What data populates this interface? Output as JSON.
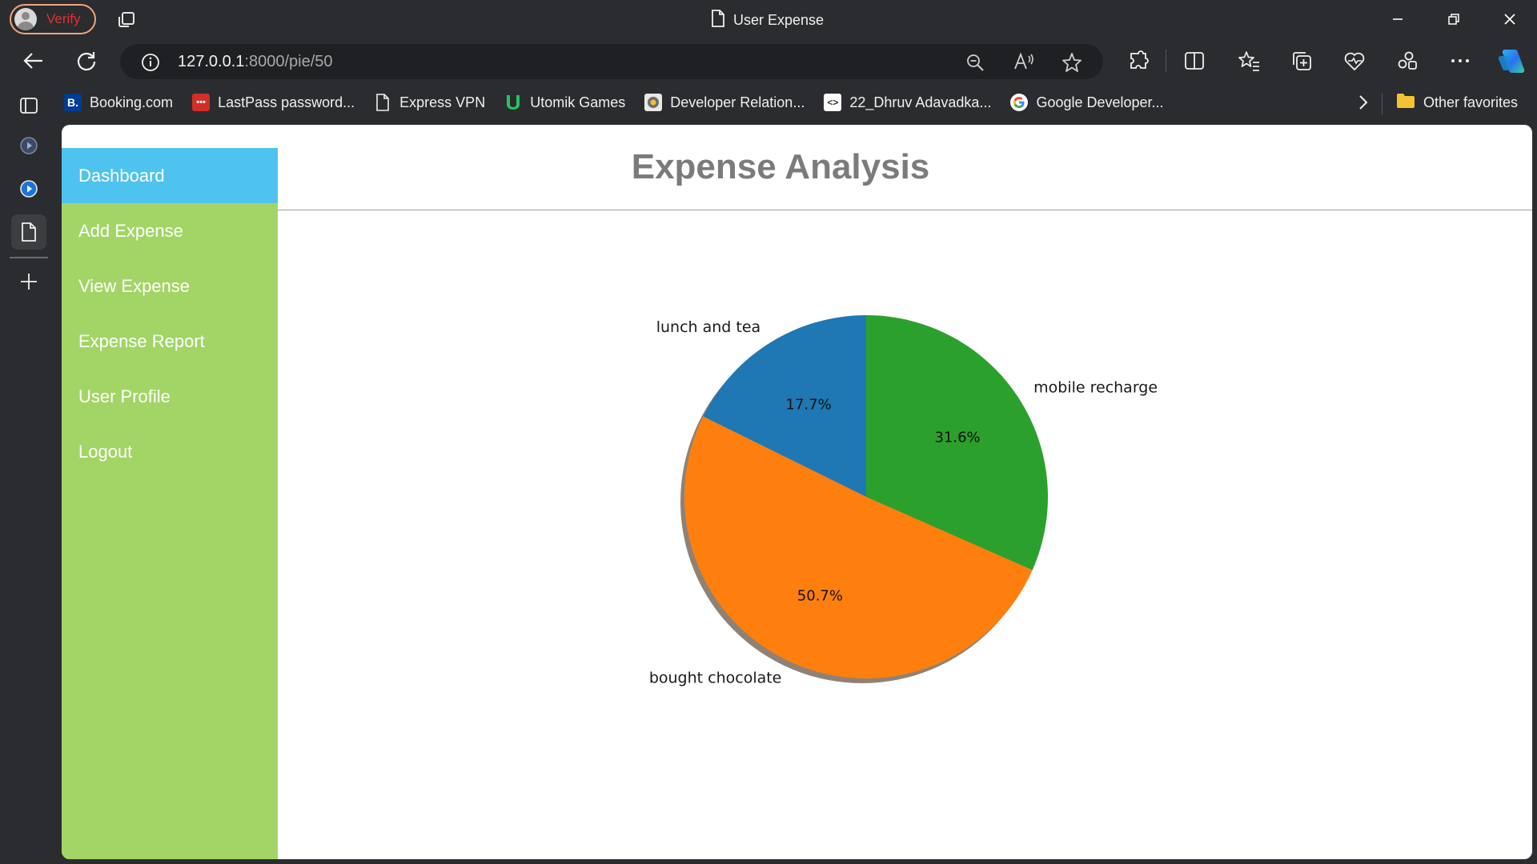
{
  "window": {
    "title": "User Expense",
    "profile_label": "Verify"
  },
  "address_bar": {
    "url_host": "127.0.0.1",
    "url_rest": ":8000/pie/50"
  },
  "favorites": [
    {
      "label": "Booking.com",
      "icon": "booking-icon",
      "color": "#003b95"
    },
    {
      "label": "LastPass password...",
      "icon": "lastpass-icon",
      "color": "#d32d27"
    },
    {
      "label": "Express VPN",
      "icon": "page-icon",
      "color": "#ffffff"
    },
    {
      "label": "Utomik Games",
      "icon": "utomik-icon",
      "color": "#22c55e"
    },
    {
      "label": "Developer Relation...",
      "icon": "developer-relations-icon",
      "color": "#8a8a8a"
    },
    {
      "label": "22_Dhruv Adavadka...",
      "icon": "code-icon",
      "color": "#ffffff"
    },
    {
      "label": "Google Developer...",
      "icon": "google-icon",
      "color": "#ffffff"
    }
  ],
  "other_favorites": "Other favorites",
  "sidebar": {
    "items": [
      {
        "label": "Dashboard",
        "active": true
      },
      {
        "label": "Add Expense",
        "active": false
      },
      {
        "label": "View Expense",
        "active": false
      },
      {
        "label": "Expense Report",
        "active": false
      },
      {
        "label": "User Profile",
        "active": false
      },
      {
        "label": "Logout",
        "active": false
      }
    ]
  },
  "page": {
    "title": "Expense Analysis"
  },
  "colors": {
    "sidebar_bg": "#a2d565",
    "sidebar_active": "#4fc3ef",
    "title_gray": "#7b7b7b"
  },
  "chart_data": {
    "type": "pie",
    "slices": [
      {
        "label": "lunch and tea",
        "value": 17.7,
        "pct_label": "17.7%",
        "color": "#1f77b4"
      },
      {
        "label": "bought chocolate",
        "value": 50.7,
        "pct_label": "50.7%",
        "color": "#ff7f0e"
      },
      {
        "label": "mobile recharge",
        "value": 31.6,
        "pct_label": "31.6%",
        "color": "#2ca02c"
      }
    ],
    "start_angle": 90,
    "direction": "counterclockwise",
    "shadow": true
  }
}
